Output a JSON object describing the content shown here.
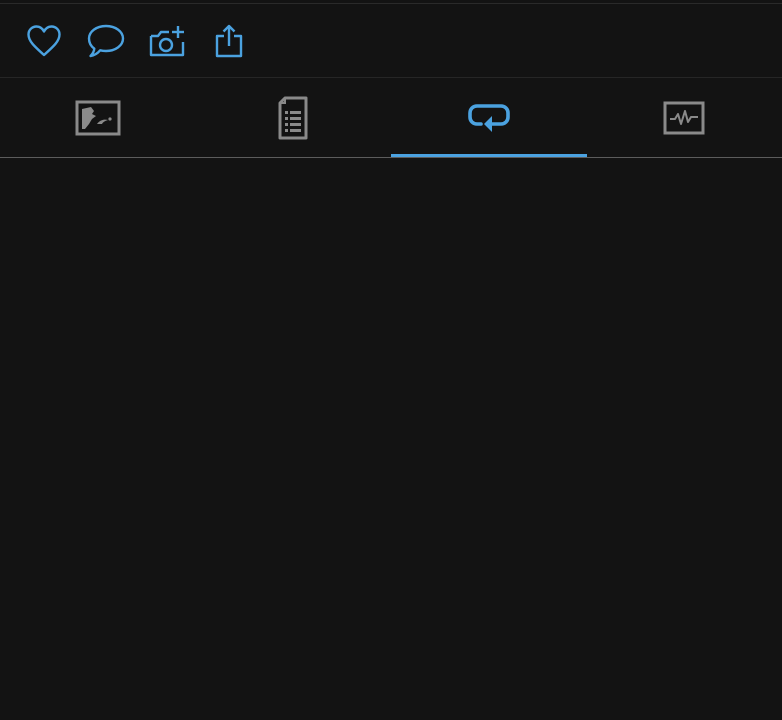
{
  "colors": {
    "accent": "#4ba2e0",
    "icon_inactive": "#8a8a8a",
    "background": "#131313"
  },
  "action_bar": {
    "buttons": [
      {
        "name": "like-button",
        "icon": "heart-icon"
      },
      {
        "name": "comment-button",
        "icon": "speech-bubble-icon"
      },
      {
        "name": "add-photo-button",
        "icon": "camera-plus-icon"
      },
      {
        "name": "share-button",
        "icon": "share-icon"
      }
    ]
  },
  "tabs": {
    "active_index": 2,
    "items": [
      {
        "name": "tab-image",
        "icon": "image-icon"
      },
      {
        "name": "tab-details",
        "icon": "document-list-icon"
      },
      {
        "name": "tab-repost",
        "icon": "repeat-icon"
      },
      {
        "name": "tab-activity",
        "icon": "activity-pulse-icon"
      }
    ]
  }
}
